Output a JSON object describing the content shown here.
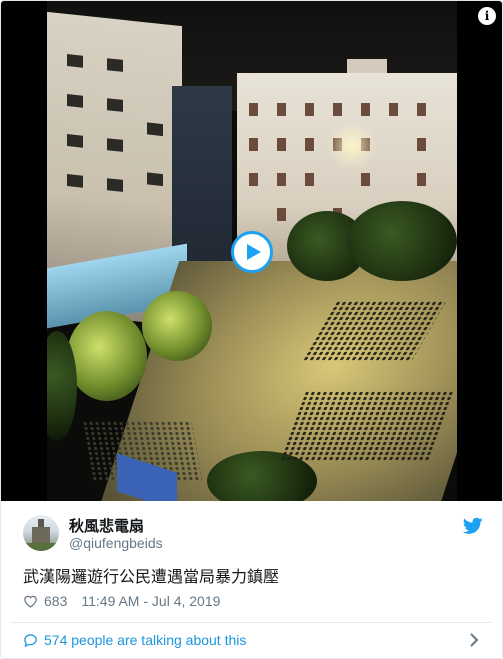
{
  "tweet": {
    "author_name": "秋風悲電扇",
    "author_handle": "@qiufengbeids",
    "text": "武漢陽邏遊行公民遭遇當局暴力鎮壓",
    "like_count": "683",
    "timestamp": "11:49 AM - Jul 4, 2019",
    "conversation_text": "574 people are talking about this"
  },
  "media": {
    "type": "video",
    "play_icon": "play-icon",
    "info_icon": "info-icon"
  },
  "icons": {
    "brand": "twitter-bird-icon",
    "like": "heart-icon",
    "conversation": "speech-bubble-icon",
    "more": "chevron-right-icon"
  },
  "colors": {
    "accent": "#1da1f2",
    "link": "#1b95e0",
    "muted": "#657786",
    "text": "#14171a"
  }
}
